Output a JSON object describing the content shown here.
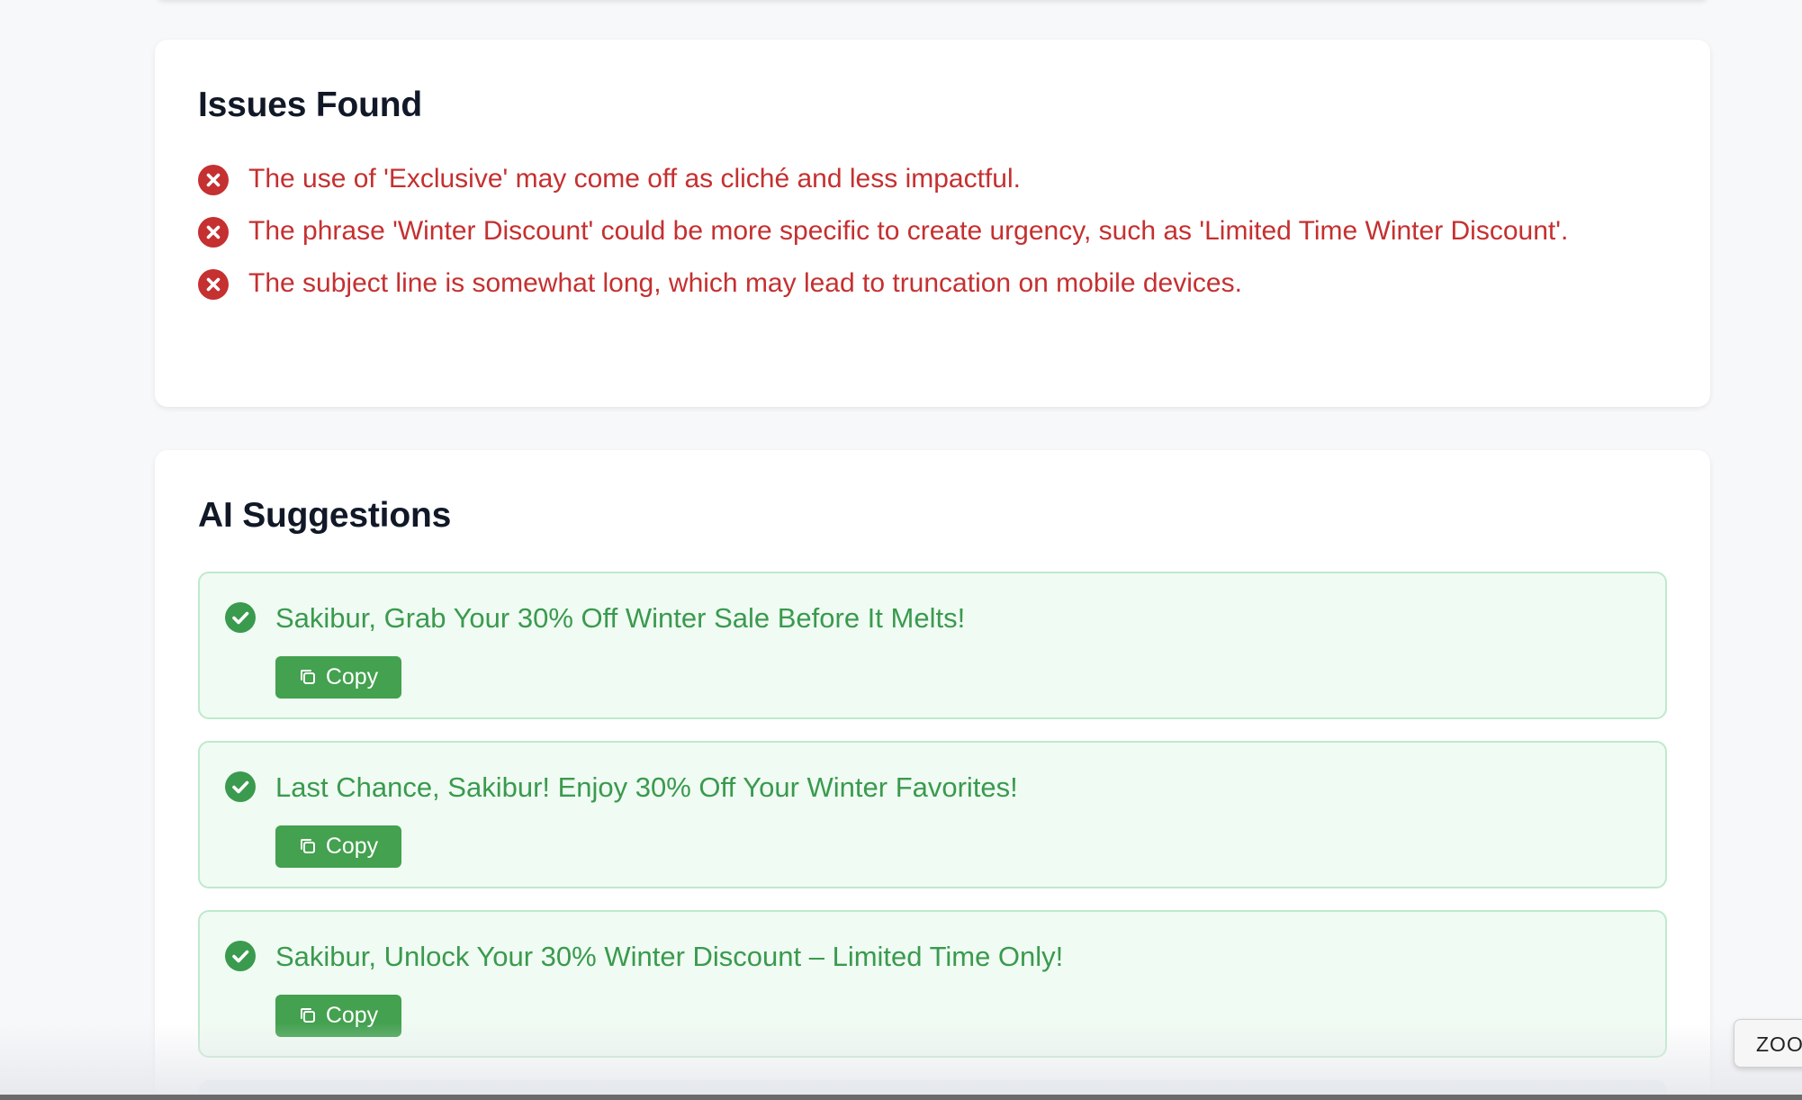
{
  "issues": {
    "title": "Issues Found",
    "items": [
      "The use of 'Exclusive' may come off as cliché and less impactful.",
      "The phrase 'Winter Discount' could be more specific to create urgency, such as 'Limited Time Winter Discount'.",
      "The subject line is somewhat long, which may lead to truncation on mobile devices."
    ],
    "icon": "error-circle-icon",
    "color": "#c53030"
  },
  "suggestions": {
    "title": "AI Suggestions",
    "items": [
      {
        "text": "Sakibur, Grab Your 30% Off Winter Sale Before It Melts!",
        "button_label": "Copy"
      },
      {
        "text": "Last Chance, Sakibur! Enjoy 30% Off Your Winter Favorites!",
        "button_label": "Copy"
      },
      {
        "text": "Sakibur, Unlock Your 30% Winter Discount – Limited Time Only!",
        "button_label": "Copy"
      }
    ],
    "icon": "check-circle-icon",
    "color": "#3a9a4e",
    "button_color": "#43a14f"
  },
  "zoom_tooltip": {
    "label": "ZOOM"
  }
}
